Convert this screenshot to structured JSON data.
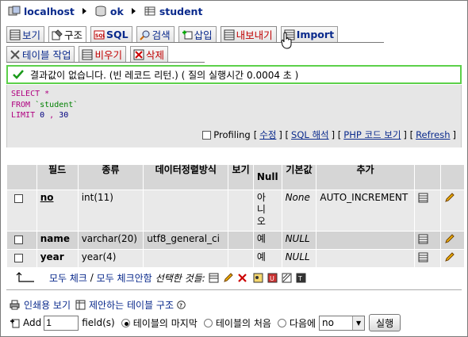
{
  "breadcrumb": {
    "server": "localhost",
    "database": "ok",
    "table": "student"
  },
  "tabs_row1": [
    {
      "label": "보기"
    },
    {
      "label": "구조"
    },
    {
      "label": "SQL"
    },
    {
      "label": "검색"
    },
    {
      "label": "삽입"
    },
    {
      "label": "내보내기"
    },
    {
      "label": "Import"
    }
  ],
  "tabs_row2": [
    {
      "label": "테이블 작업"
    },
    {
      "label": "비우기"
    },
    {
      "label": "삭제"
    }
  ],
  "message": "결과값이 없습니다. (빈 레코드 리턴.) ( 질의 실행시간 0.0004 초 )",
  "sql": {
    "line1_kw": "SELECT",
    "line1_rest": " *",
    "line2_kw": "FROM",
    "line2_str": " `student`",
    "line3_kw": "LIMIT",
    "line3_num1": " 0",
    "line3_sep": " ,",
    "line3_num2": " 30"
  },
  "sql_links": {
    "profiling": "Profiling",
    "lb1": "[",
    "edit": "수정",
    "rb1": "] [",
    "explain": "SQL 해석",
    "rb2": "] [",
    "php": "PHP 코드 보기",
    "rb3": "] [",
    "refresh": "Refresh",
    "rb4": "]"
  },
  "columns": {
    "field": "필드",
    "type": "종류",
    "collation": "데이터정렬방식",
    "attributes": "보기",
    "null": "Null",
    "default": "기본값",
    "extra": "추가"
  },
  "rows": [
    {
      "field": "no",
      "type": "int(11)",
      "collation": "",
      "null": "아니오",
      "default": "None",
      "extra": "AUTO_INCREMENT"
    },
    {
      "field": "name",
      "type": "varchar(20)",
      "collation": "utf8_general_ci",
      "null": "예",
      "default": "NULL",
      "extra": ""
    },
    {
      "field": "year",
      "type": "year(4)",
      "collation": "",
      "null": "예",
      "default": "NULL",
      "extra": ""
    }
  ],
  "bulk": {
    "check_all": "모두 체크",
    "slash": " / ",
    "uncheck_all": "모두 체크안함",
    "with_selected": "선택한 것들:"
  },
  "print_view": "인쇄용 보기",
  "propose_structure": "제안하는 테이블 구조",
  "add": {
    "label": "Add",
    "value": "1",
    "fields_label": "field(s)",
    "opt_end": "테이블의 마지막",
    "opt_begin": "테이블의 처음",
    "opt_after": "다음에",
    "after_select": "no",
    "go": "실행"
  }
}
